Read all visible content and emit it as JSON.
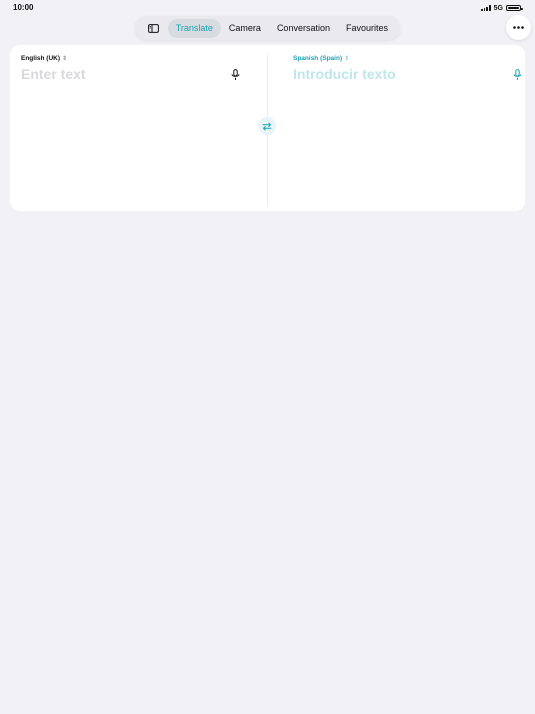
{
  "status": {
    "time": "10:00",
    "network": "5G"
  },
  "tabs": {
    "sidebar_icon": "sidebar-left-icon",
    "items": [
      {
        "label": "Translate",
        "active": true
      },
      {
        "label": "Camera",
        "active": false
      },
      {
        "label": "Conversation",
        "active": false
      },
      {
        "label": "Favourites",
        "active": false
      }
    ]
  },
  "more_icon": "ellipsis-icon",
  "source": {
    "language": "English (UK)",
    "placeholder": "Enter text"
  },
  "target": {
    "language": "Spanish (Spain)",
    "placeholder": "Introducir texto"
  },
  "colors": {
    "accent": "#1aa3b1",
    "background": "#f1f1f6",
    "card": "#ffffff"
  }
}
